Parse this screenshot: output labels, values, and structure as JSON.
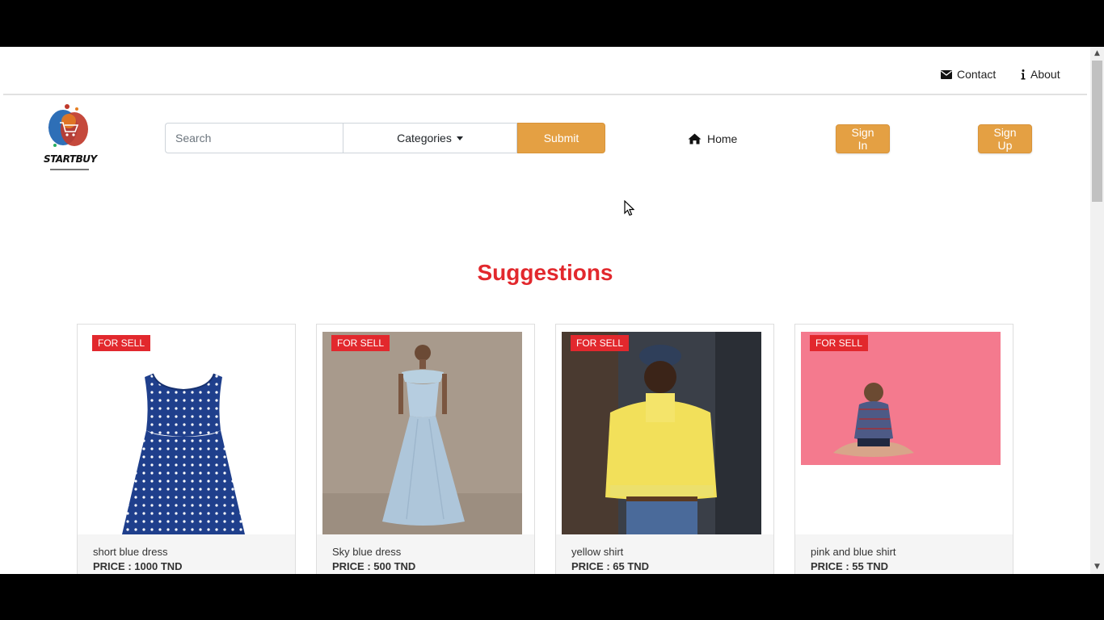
{
  "topbar": {
    "contact_label": "Contact",
    "about_label": "About"
  },
  "header": {
    "logo_text": "STARTBUY",
    "search_placeholder": "Search",
    "categories_label": "Categories",
    "submit_label": "Submit",
    "home_label": "Home",
    "signin_label": "Sign In",
    "signup_label": "Sign Up"
  },
  "main": {
    "section_title": "Suggestions",
    "products": [
      {
        "badge": "FOR SELL",
        "name": "short blue dress",
        "price": "PRICE : 1000 TND"
      },
      {
        "badge": "FOR SELL",
        "name": "Sky blue dress",
        "price": "PRICE : 500 TND"
      },
      {
        "badge": "FOR SELL",
        "name": "yellow shirt",
        "price": "PRICE : 65 TND"
      },
      {
        "badge": "FOR SELL",
        "name": "pink and blue shirt",
        "price": "PRICE : 55 TND"
      }
    ]
  },
  "colors": {
    "accent": "#e4a043",
    "title_red": "#e2282d",
    "badge_red": "#e2282d"
  },
  "icons": {
    "contact": "envelope-icon",
    "about": "info-icon",
    "home": "home-icon",
    "categories": "caret-down-icon"
  }
}
